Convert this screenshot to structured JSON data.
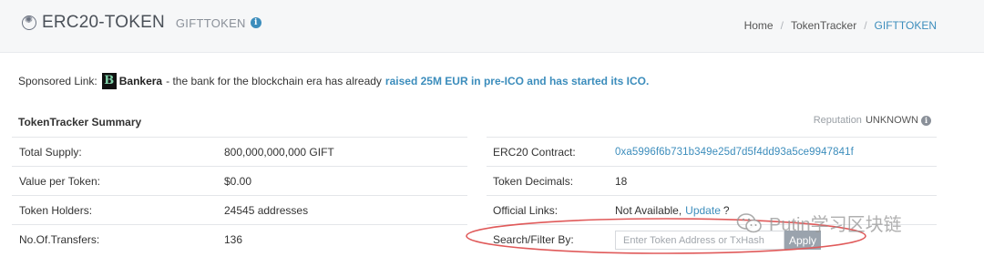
{
  "header": {
    "token_name": "ERC20-TOKEN",
    "token_subtitle": "GIFTTOKEN",
    "token_icon": "token-logo-icon",
    "breadcrumb": [
      {
        "label": "Home"
      },
      {
        "label": "TokenTracker"
      },
      {
        "label": "GIFTTOKEN"
      }
    ]
  },
  "sponsored": {
    "prefix": "Sponsored Link:",
    "brand_logo_letter": "B",
    "brand": "Bankera",
    "text": "- the bank for the blockchain era has already",
    "highlight": "raised 25M EUR in pre-ICO and has started its ICO."
  },
  "summary": {
    "title": "TokenTracker Summary",
    "reputation_label": "Reputation",
    "reputation_value": "UNKNOWN",
    "left_rows": [
      {
        "label": "Total Supply:",
        "value": "800,000,000,000 GIFT"
      },
      {
        "label": "Value per Token:",
        "value": "$0.00"
      },
      {
        "label": "Token Holders:",
        "value": "24545 addresses"
      },
      {
        "label": "No.Of.Transfers:",
        "value": "136"
      }
    ],
    "right_rows": {
      "contract_label": "ERC20 Contract:",
      "contract_value": "0xa5996f6b731b349e25d7d5f4dd93a5ce9947841f",
      "decimals_label": "Token Decimals:",
      "decimals_value": "18",
      "links_label": "Official Links:",
      "links_value": "Not Available,",
      "links_update": "Update",
      "links_suffix": "?",
      "filter_label": "Search/Filter By:",
      "filter_placeholder": "Enter Token Address or TxHash",
      "apply_label": "Apply"
    }
  },
  "watermark": {
    "text": "Putin学习区块链"
  },
  "colors": {
    "accent": "#3c8dbc",
    "annotation": "#e05a5a",
    "header_bg": "#f6f7f8"
  }
}
